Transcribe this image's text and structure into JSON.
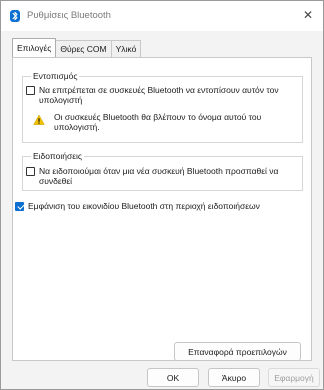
{
  "window": {
    "title": "Ρυθμίσεις Bluetooth"
  },
  "tabs": [
    {
      "label": "Επιλογές",
      "active": true
    },
    {
      "label": "Θύρες COM",
      "active": false
    },
    {
      "label": "Υλικό",
      "active": false
    }
  ],
  "discovery": {
    "title": "Εντοπισμός",
    "checkbox_label": "Να επιτρέπεται σε συσκευές Bluetooth να εντοπίσουν αυτόν τον υπολογιστή",
    "checked": false,
    "warning": "Οι συσκευές Bluetooth θα βλέπουν το όνομα αυτού του υπολογιστή."
  },
  "notifications": {
    "title": "Ειδοποιήσεις",
    "checkbox_label": "Να ειδοποιούμαι όταν μια νέα συσκευή Bluetooth προσπαθεί να συνδεθεί",
    "checked": false
  },
  "tray_option": {
    "label": "Εμφάνιση του εικονιδίου Bluetooth στη περιοχή ειδοποιήσεων",
    "checked": true
  },
  "buttons": {
    "restore_defaults": "Επαναφορά προεπιλογών",
    "ok": "OK",
    "cancel": "Άκυρο",
    "apply": "Εφαρμογή"
  },
  "colors": {
    "accent": "#0a6fd1",
    "warning": "#f2c200"
  },
  "icons": {
    "title": "bluetooth-icon",
    "warning": "warning-icon",
    "close": "close-icon"
  }
}
